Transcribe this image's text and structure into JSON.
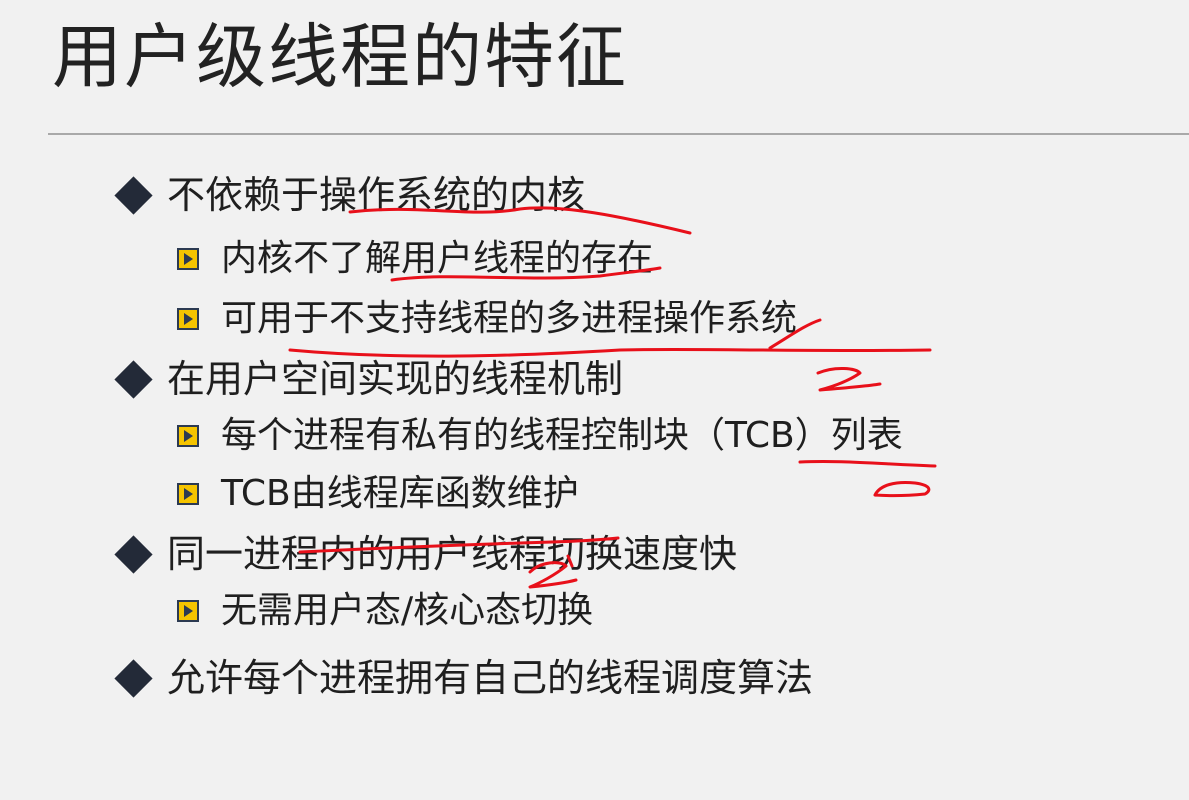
{
  "slide": {
    "title": "用户级线程的特征",
    "items": [
      {
        "level": 1,
        "text": "不依赖于操作系统的内核"
      },
      {
        "level": 2,
        "text": "内核不了解用户线程的存在"
      },
      {
        "level": 2,
        "text": "可用于不支持线程的多进程操作系统"
      },
      {
        "level": 1,
        "text": "在用户空间实现的线程机制"
      },
      {
        "level": 2,
        "text": "每个进程有私有的线程控制块（TCB）列表"
      },
      {
        "level": 2,
        "text": "TCB由线程库函数维护"
      },
      {
        "level": 1,
        "text": "同一进程内的用户线程切换速度快"
      },
      {
        "level": 2,
        "text": "无需用户态/核心态切换"
      },
      {
        "level": 1,
        "text": "允许每个进程拥有自己的线程调度算法"
      }
    ]
  },
  "colors": {
    "background": "#f1f1f1",
    "title_text": "#222222",
    "body_text": "#1f1f1f",
    "bullet_diamond": "#232a38",
    "bullet_square_fill": "#f5c400",
    "bullet_square_border": "#2c3a52",
    "annotation_ink": "#e8101a"
  },
  "icons": {
    "level1_bullet": "diamond-bullet-icon",
    "level2_bullet": "square-arrow-bullet-icon"
  }
}
